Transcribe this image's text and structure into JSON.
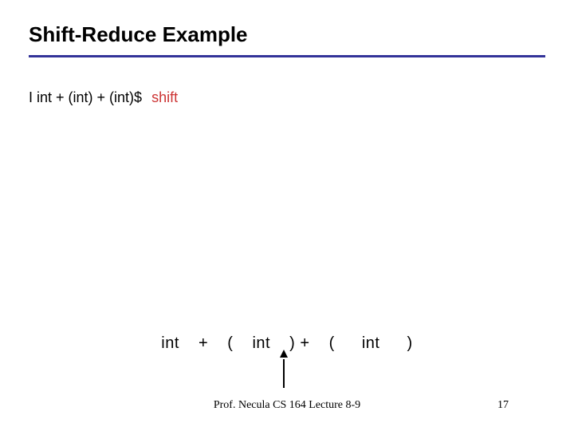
{
  "slide": {
    "title": "Shift-Reduce Example",
    "parse_state": "I int + (int) + (int)$",
    "parse_action": "shift",
    "tokens": {
      "t1": "int",
      "t2": "+",
      "t3": "(",
      "t4": "int",
      "t5": ") +",
      "t6": "(",
      "t7": "int",
      "t8": ")"
    },
    "footer_text": "Prof. Necula  CS 164  Lecture 8-9",
    "page_number": "17"
  }
}
